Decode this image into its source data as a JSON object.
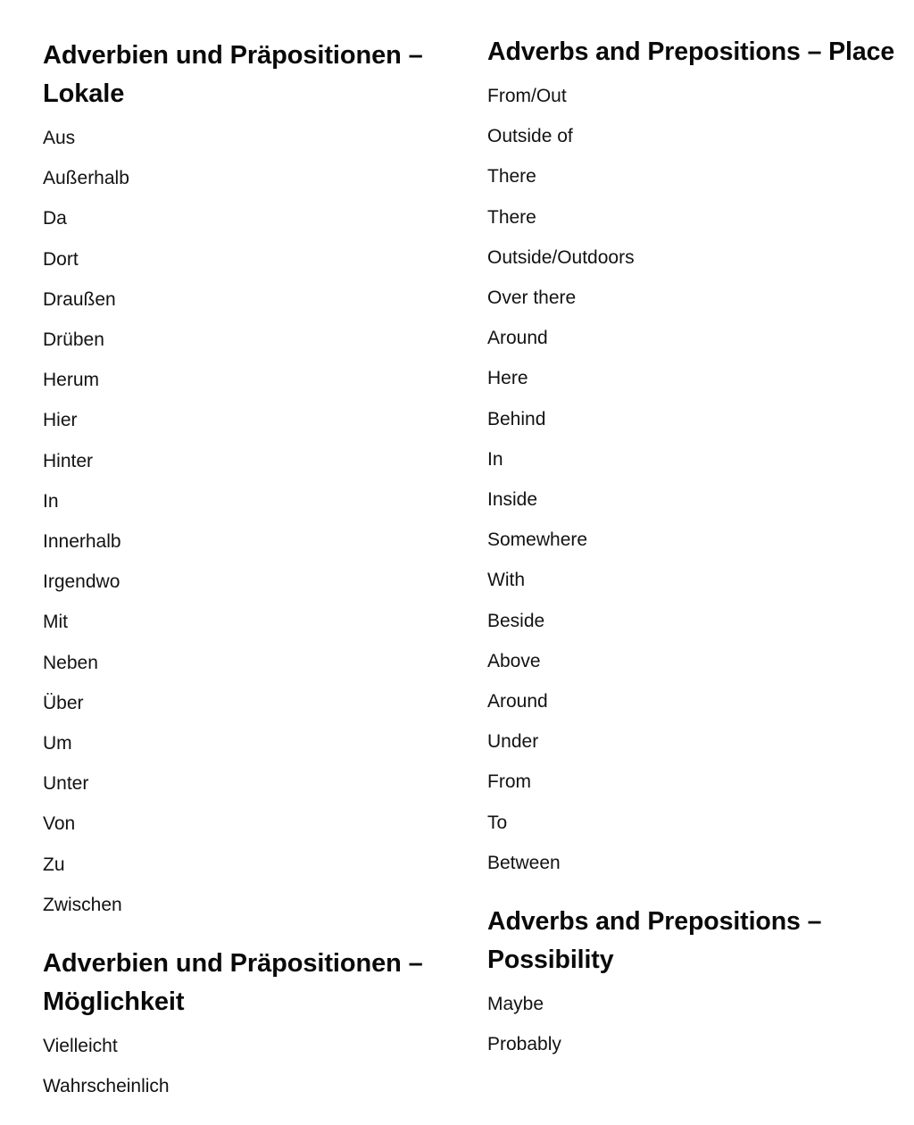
{
  "document": {
    "title": "Adverbien und Präpositionen",
    "background_color": "#ffffff",
    "text_color": "#121212",
    "heading_color": "#0a0a0a"
  },
  "columns": [
    {
      "name": "german",
      "language": "German",
      "sections": [
        {
          "heading": "Adverbien und Präpositionen – Lokale",
          "items": [
            "Aus",
            "Außerhalb",
            "Da",
            "Dort",
            "Draußen",
            "Drüben",
            "Herum",
            "Hier",
            "Hinter",
            "In",
            "Innerhalb",
            "Irgendwo",
            "Mit",
            "Neben",
            "Über",
            "Um",
            "Unter",
            "Von",
            "Zu",
            "Zwischen"
          ]
        },
        {
          "heading": "Adverbien und Präpositionen – Möglichkeit",
          "items": [
            "Vielleicht",
            "Wahrscheinlich"
          ]
        }
      ]
    },
    {
      "name": "english",
      "language": "English",
      "sections": [
        {
          "heading": "Adverbs and Prepositions – Place",
          "items": [
            "From/Out",
            "Outside of",
            "There",
            "There",
            "Outside/Outdoors",
            "Over there",
            "Around",
            "Here",
            "Behind",
            "In",
            "Inside",
            "Somewhere",
            "With",
            "Beside",
            "Above",
            "Around",
            "Under",
            "From",
            "To",
            "Between"
          ]
        },
        {
          "heading": "Adverbs and Prepositions – Possibility",
          "items": [
            "Maybe",
            "Probably"
          ]
        }
      ]
    }
  ]
}
